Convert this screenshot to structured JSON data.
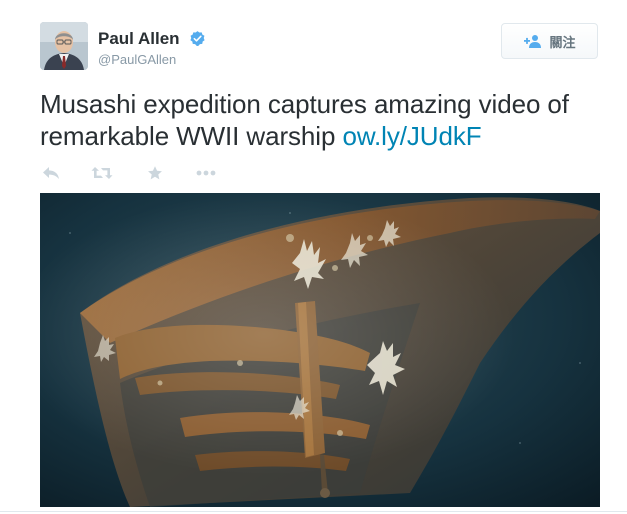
{
  "tweet": {
    "author": {
      "display_name": "Paul Allen",
      "username": "@PaulGAllen",
      "verified": true
    },
    "follow_button": {
      "label": "關注",
      "icon": "add-user-icon"
    },
    "text": "Musashi expedition captures amazing video of remarkable WWII warship ",
    "link": "ow.ly/JUdkF",
    "actions": [
      {
        "name": "reply",
        "icon": "reply-icon"
      },
      {
        "name": "retweet",
        "icon": "retweet-icon"
      },
      {
        "name": "favorite",
        "icon": "star-icon"
      },
      {
        "name": "more",
        "icon": "more-icon"
      }
    ],
    "media": {
      "type": "photo"
    }
  },
  "colors": {
    "text": "#292f33",
    "muted": "#8899a6",
    "link": "#0084b4",
    "verified": "#55acee",
    "action_icon": "#ccd6dd"
  }
}
